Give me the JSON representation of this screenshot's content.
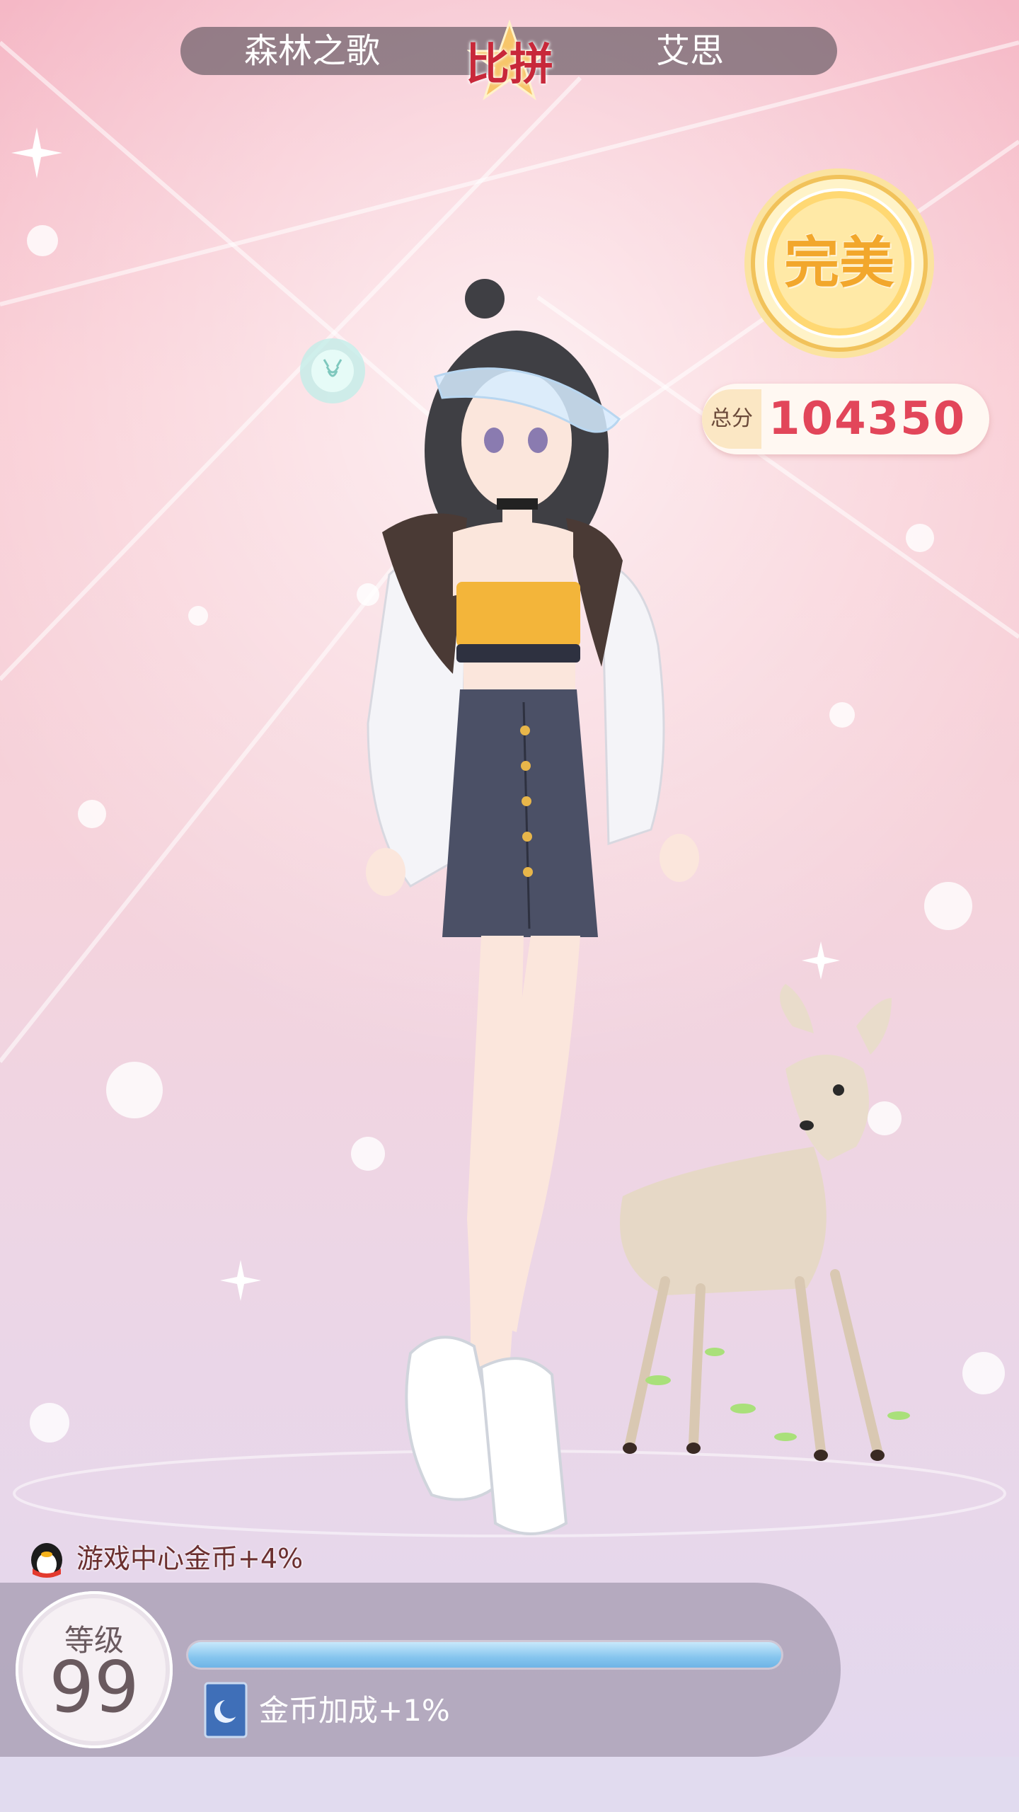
{
  "versus": {
    "left_player": "森林之歌",
    "center_label": "比拼",
    "right_player": "艾思"
  },
  "result": {
    "rating": "完美",
    "total_label": "总分",
    "total_score": "104350"
  },
  "bonus": {
    "game_center": "游戏中心金币+4%",
    "coin_bonus": "金币加成+1%"
  },
  "level": {
    "title": "等级",
    "value": "99",
    "progress": 1.0
  },
  "icons": {
    "star": "star-icon",
    "medal": "medal-icon",
    "orb": "deer-spirit-orb-icon",
    "qq": "qq-penguin-icon",
    "book": "moon-book-icon"
  },
  "colors": {
    "versus_accent": "#c8283a",
    "score": "#e2465a",
    "medal_gold": "#f2a72c",
    "progress": "#86c5ee"
  }
}
